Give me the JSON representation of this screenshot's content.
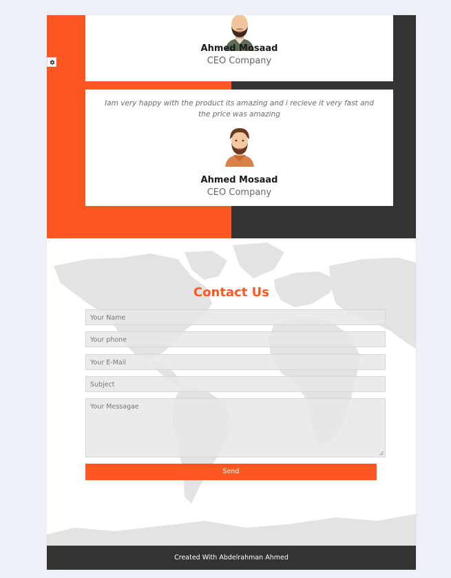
{
  "colors": {
    "accent": "#ff5722",
    "dark": "#333333",
    "page_bg": "#eef1f8",
    "map": "#e3e3e3"
  },
  "testimonials": [
    {
      "quote": "",
      "name": "Ahmed Mosaad",
      "role": "CEO Company",
      "avatar_icon": "bearded-man-avatar-icon"
    },
    {
      "quote": "Iam very happy with the product its amazing and i recieve it very fast and the price was amazing",
      "name": "Ahmed Mosaad",
      "role": "CEO Company",
      "avatar_icon": "bearded-man-avatar-icon"
    }
  ],
  "settings": {
    "icon": "gear-icon"
  },
  "contact": {
    "title": "Contact Us",
    "fields": {
      "name_placeholder": "Your Name",
      "phone_placeholder": "Your phone",
      "email_placeholder": "Your E-Mail",
      "subject_placeholder": "Subject",
      "message_placeholder": "Your Messagae"
    },
    "send_label": "Send"
  },
  "footer": {
    "text": "Created With Abdelrahman Ahmed"
  }
}
